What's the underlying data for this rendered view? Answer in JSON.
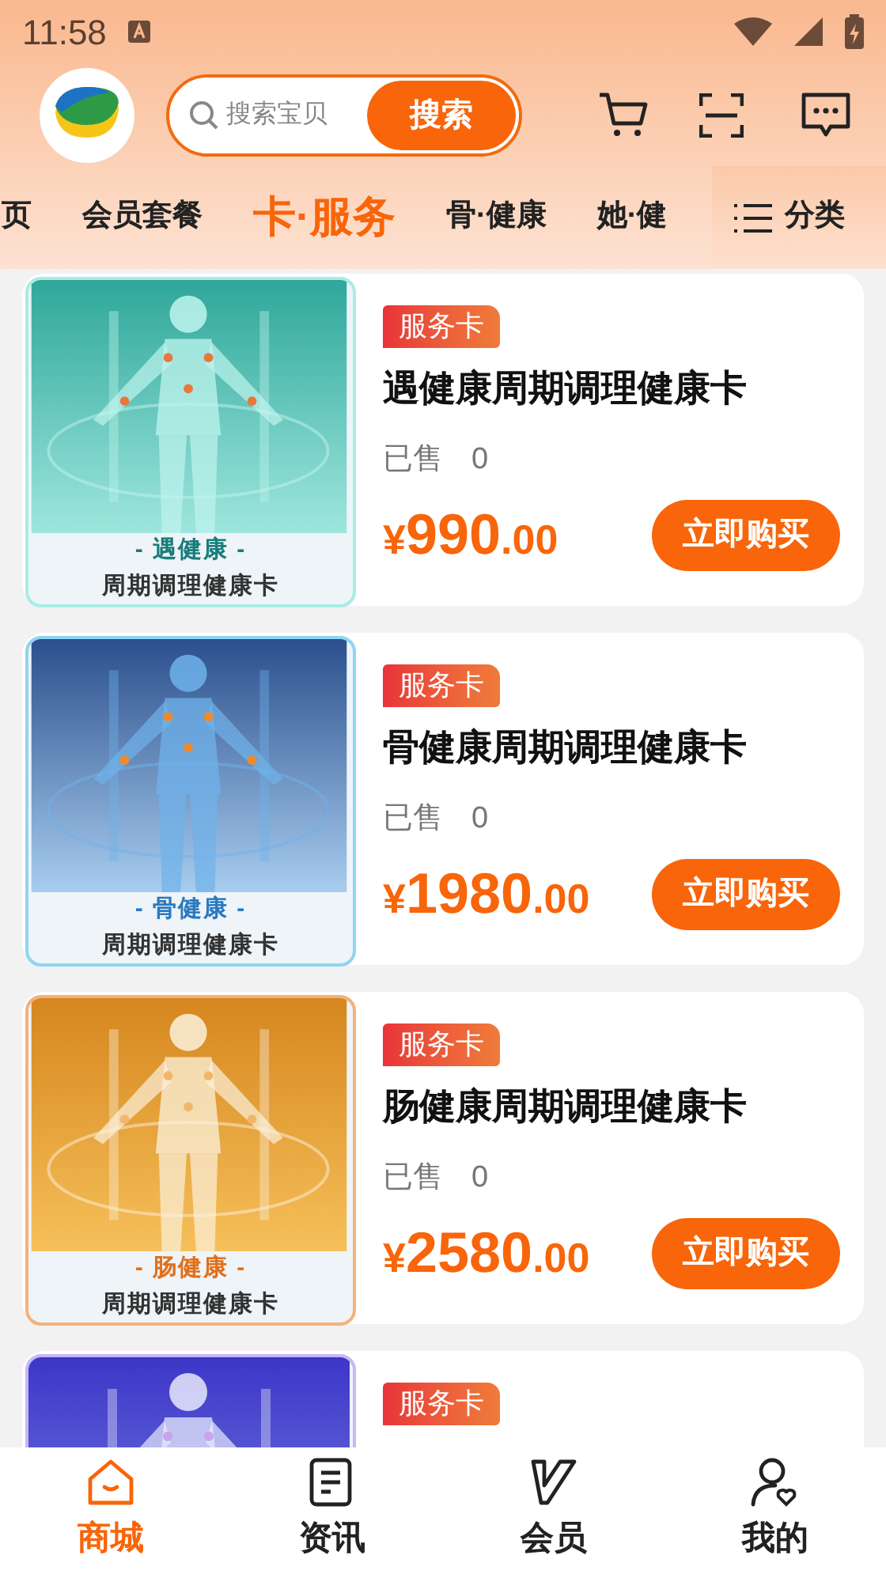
{
  "status_bar": {
    "time": "11:58"
  },
  "header": {
    "search": {
      "placeholder": "搜索宝贝",
      "button": "搜索"
    }
  },
  "tabs": [
    {
      "label": "页",
      "selected": false
    },
    {
      "label": "会员套餐",
      "selected": false
    },
    {
      "label": "卡·服务",
      "selected": true
    },
    {
      "label": "骨·健康",
      "selected": false
    },
    {
      "label": "她·健",
      "selected": false
    }
  ],
  "category_button": "分类",
  "products": [
    {
      "color": "#a8ece4",
      "caption_1": "- 遇健康 -",
      "caption_2": "周期调理健康卡",
      "badge": "服务卡",
      "title": "遇健康周期调理健康卡",
      "sold_label": "已售",
      "sold": "0",
      "currency": "¥",
      "price": "990",
      "cents": ".00",
      "buy": "立即购买"
    },
    {
      "color": "#8fd4f2",
      "caption_1": "- 骨健康 -",
      "caption_2": "周期调理健康卡",
      "badge": "服务卡",
      "title": "骨健康周期调理健康卡",
      "sold_label": "已售",
      "sold": "0",
      "currency": "¥",
      "price": "1980",
      "cents": ".00",
      "buy": "立即购买"
    },
    {
      "color": "#f3b27a",
      "caption_1": "- 肠健康 -",
      "caption_2": "周期调理健康卡",
      "badge": "服务卡",
      "title": "肠健康周期调理健康卡",
      "sold_label": "已售",
      "sold": "0",
      "currency": "¥",
      "price": "2580",
      "cents": ".00",
      "buy": "立即购买"
    },
    {
      "color": "#c6b8f6",
      "badge": "服务卡"
    }
  ],
  "bottom_nav": [
    {
      "kind": "home",
      "label": "商城",
      "selected": true
    },
    {
      "kind": "news",
      "label": "资讯",
      "selected": false
    },
    {
      "kind": "member",
      "label": "会员",
      "selected": false
    },
    {
      "kind": "profile",
      "label": "我的",
      "selected": false
    }
  ]
}
